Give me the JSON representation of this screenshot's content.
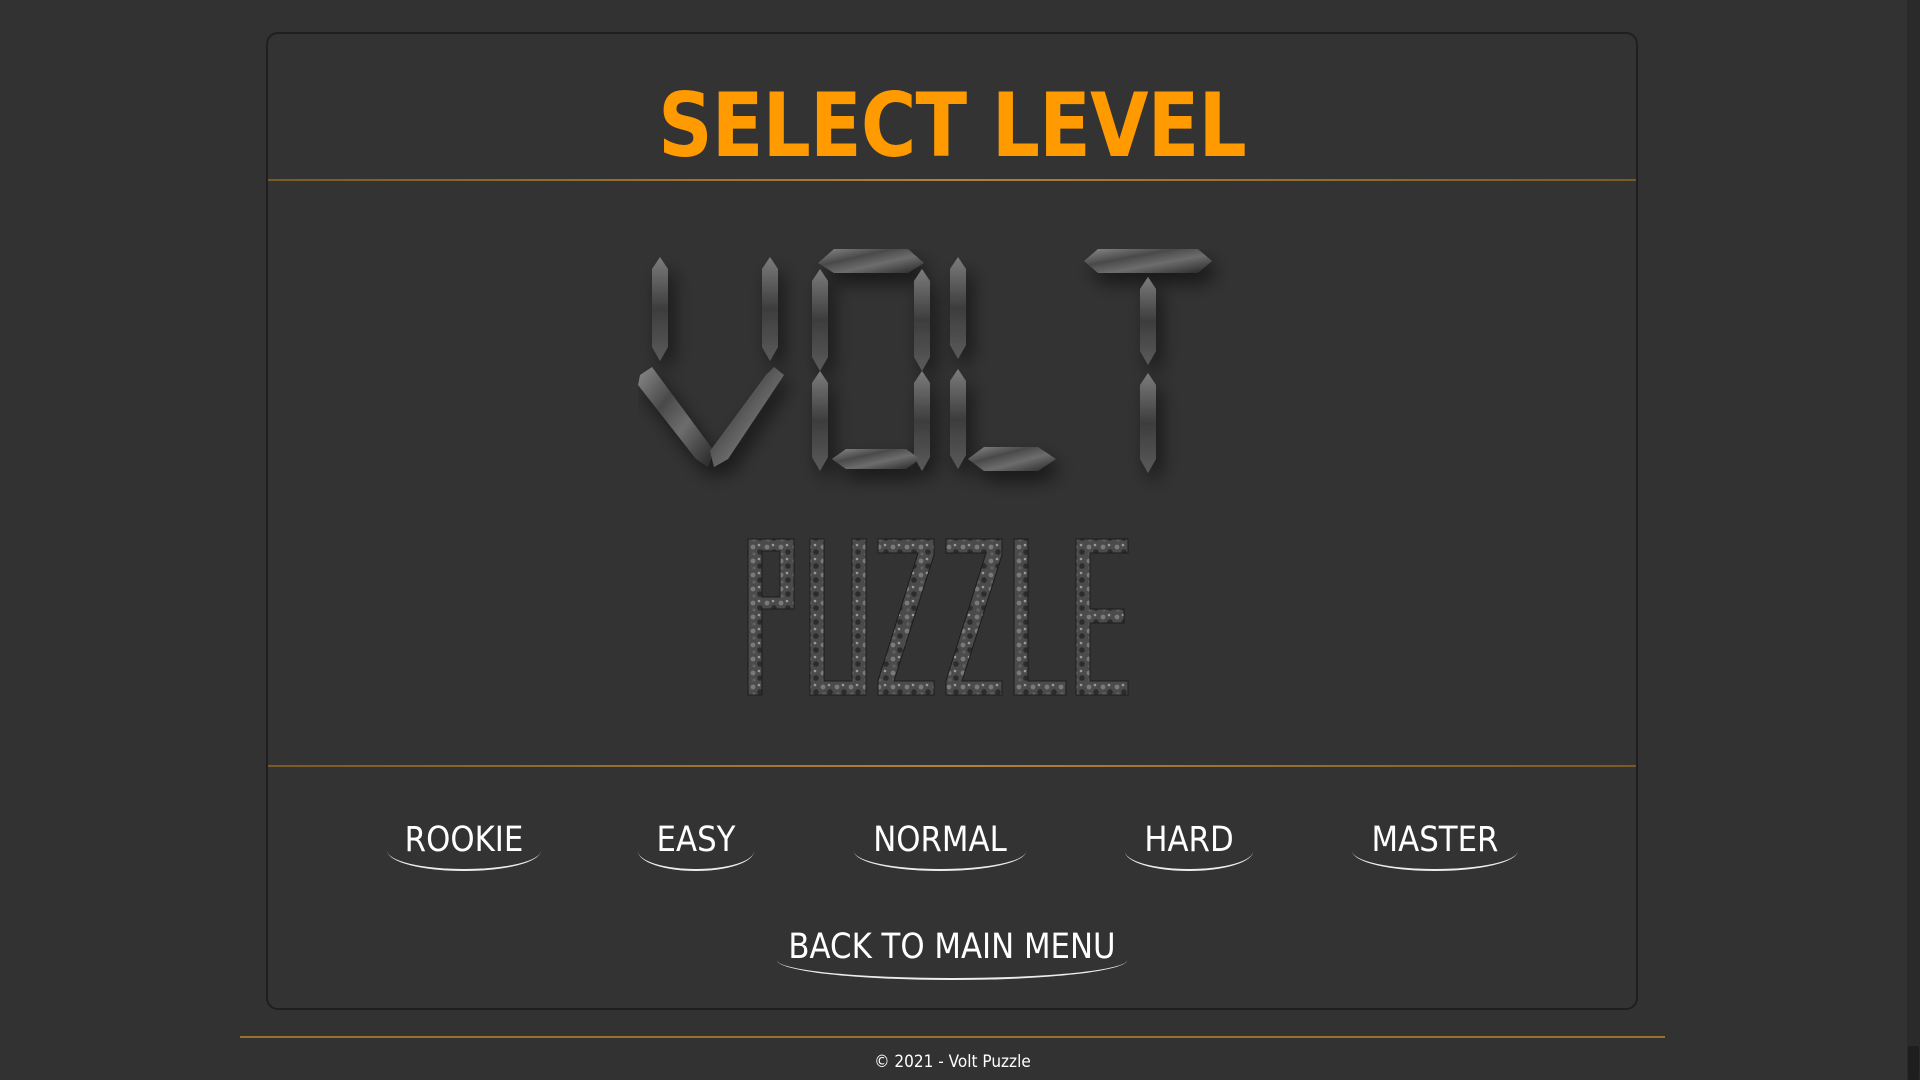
{
  "screen": {
    "title": "SELECT LEVEL",
    "logo": {
      "word_top": "VOLT",
      "word_bottom": "PUZZLE"
    }
  },
  "levels": [
    {
      "label": "ROOKIE"
    },
    {
      "label": "EASY"
    },
    {
      "label": "NORMAL"
    },
    {
      "label": "HARD"
    },
    {
      "label": "MASTER"
    }
  ],
  "navigation": {
    "back_label": "BACK TO MAIN MENU"
  },
  "footer": {
    "copyright": "© 2021 - Volt Puzzle"
  },
  "colors": {
    "accent": "#ff9a00",
    "background": "#323232",
    "divider": "#b0823a"
  },
  "icons": {
    "logo": "volt-puzzle-logo"
  }
}
